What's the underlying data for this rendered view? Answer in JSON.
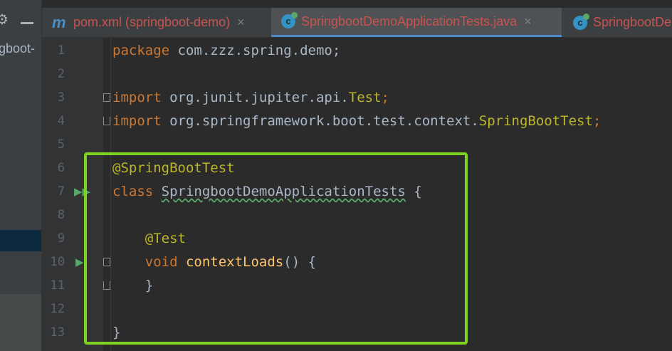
{
  "project_panel": {
    "root_fragment": "gboot-",
    "gear_icon": "gear-icon",
    "minimize_icon": "minimize-icon"
  },
  "tabs": [
    {
      "icon": "maven-m-icon",
      "label": "pom.xml (springboot-demo)",
      "close": "×",
      "active": false
    },
    {
      "icon": "class-c-icon",
      "label": "SpringbootDemoApplicationTests.java",
      "close": "×",
      "active": true
    },
    {
      "icon": "class-c-icon",
      "label": "SpringbootDe",
      "active": false
    }
  ],
  "editor": {
    "line_numbers": [
      "1",
      "2",
      "3",
      "4",
      "5",
      "6",
      "7",
      "8",
      "9",
      "10",
      "11",
      "12",
      "13"
    ],
    "lines": {
      "l1": {
        "kw": "package",
        "rest": " com.zzz.spring.demo;"
      },
      "l3": {
        "kw": "import",
        "pkg": " org.junit.jupiter.api.",
        "cls": "Test",
        "semi": ";"
      },
      "l4": {
        "kw": "import",
        "pkg": " org.springframework.boot.test.context.",
        "cls": "SpringBootTest",
        "semi": ";"
      },
      "l6": {
        "ann": "@SpringBootTest"
      },
      "l7": {
        "kw": "class",
        "name": "SpringbootDemoApplicationTests",
        "brace": " {"
      },
      "l9": {
        "ann": "    @Test"
      },
      "l10": {
        "kw": "    void",
        "fn": "contextLoads",
        "rest": "() {"
      },
      "l11": {
        "text": "    }"
      },
      "l13": {
        "text": "}"
      }
    }
  },
  "colors": {
    "keyword": "#cc7832",
    "annotation": "#bbb529",
    "method": "#ffc66d",
    "text": "#a9b7c6",
    "highlight_box": "#7ed321",
    "error_tab": "#c75450"
  }
}
